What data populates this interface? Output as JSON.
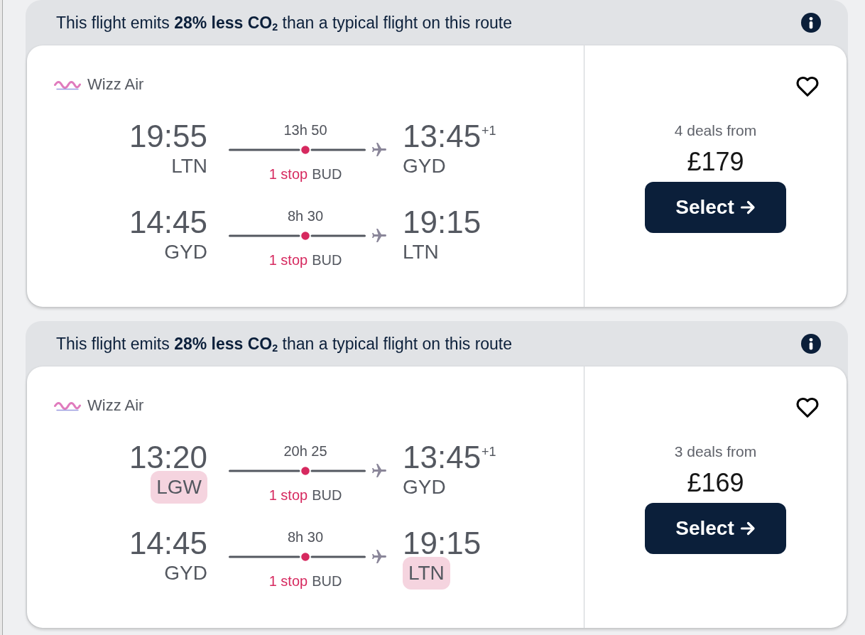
{
  "results": [
    {
      "eco_note": "This flight emits **28% less CO**$_{2}$ than a typical flight on this route",
      "airline": "Wizz Air",
      "saved": false,
      "legs": [
        {
          "departure": {
            "time": "19:55",
            "airport": "LTN",
            "highlighted": false
          },
          "duration": "13h 50",
          "stops": "1 stop",
          "via": "BUD",
          "arrival": {
            "time": "13:45",
            "day_offset": "+1",
            "airport": "GYD",
            "highlighted": false
          }
        },
        {
          "departure": {
            "time": "14:45",
            "airport": "GYD",
            "highlighted": false
          },
          "duration": "8h 30",
          "stops": "1 stop",
          "via": "BUD",
          "arrival": {
            "time": "19:15",
            "airport": "LTN",
            "highlighted": false
          }
        }
      ],
      "deals": "4 deals from",
      "price": "£179",
      "select_button": "Select"
    },
    {
      "eco_note": "This flight emits **28% less CO**$_{2}$ than a typical flight on this route",
      "airline": "Wizz Air",
      "saved": false,
      "legs": [
        {
          "departure": {
            "time": "13:20",
            "airport": "LGW",
            "highlighted": true
          },
          "duration": "20h 25",
          "stops": "1 stop",
          "via": "BUD",
          "arrival": {
            "time": "13:45",
            "day_offset": "+1",
            "airport": "GYD",
            "highlighted": false
          }
        },
        {
          "departure": {
            "time": "14:45",
            "airport": "GYD",
            "highlighted": false
          },
          "duration": "8h 30",
          "stops": "1 stop",
          "via": "BUD",
          "arrival": {
            "time": "19:15",
            "airport": "LTN",
            "highlighted": true
          }
        }
      ],
      "deals": "3 deals from",
      "price": "£169",
      "select_button": "Select"
    }
  ]
}
